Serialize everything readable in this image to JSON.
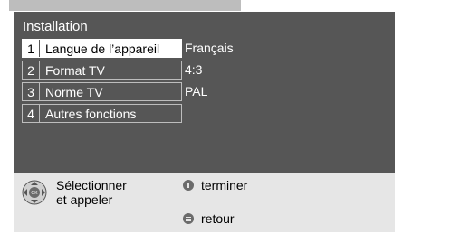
{
  "osd": {
    "title": "Installation",
    "items": [
      {
        "num": "1",
        "label": "Langue de l’appareil",
        "value": "Français",
        "selected": true
      },
      {
        "num": "2",
        "label": "Format TV",
        "value": "4:3",
        "selected": false
      },
      {
        "num": "3",
        "label": "Norme TV",
        "value": "PAL",
        "selected": false
      },
      {
        "num": "4",
        "label": "Autres fonctions",
        "value": "",
        "selected": false
      }
    ]
  },
  "legend": {
    "select_line1": "Sélectionner",
    "select_line2": "et appeler",
    "finish": "terminer",
    "back": "retour"
  },
  "colors": {
    "osd_background": "#565656",
    "legend_background": "#e6e6e6",
    "selected_item": "#ffffff"
  }
}
